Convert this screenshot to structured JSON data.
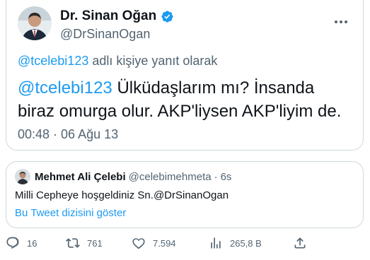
{
  "tweet": {
    "author_name": "Dr. Sinan Oğan",
    "author_handle": "@DrSinanOgan",
    "reply_to_handle": "@tcelebi123",
    "reply_to_suffix": " adlı kişiye yanıt olarak",
    "text_mention": "@tcelebi123",
    "text_body": " Ülküdaşlarım mı? İnsanda biraz omurga olur. AKP'liysen AKP'liyim de.",
    "time": "00:48",
    "separator": " · ",
    "date": "06 Ağu 13"
  },
  "quote": {
    "name": "Mehmet Ali Çelebi",
    "handle": "@celebimehmeta",
    "separator": "·",
    "time": "6s",
    "text": "Milli Cepheye hoşgeldiniz Sn.@DrSinanOgan",
    "link": "Bu Tweet dizisini göster"
  },
  "actions": {
    "replies": "16",
    "retweets": "761",
    "likes": "7.594",
    "views": "265,8 B"
  },
  "colors": {
    "accent": "#1d9bf0",
    "secondary_text": "#536471",
    "border": "#cfd9de"
  },
  "icons": [
    "verified-badge-icon",
    "more-icon",
    "reply-icon",
    "retweet-icon",
    "like-icon",
    "views-icon",
    "share-icon"
  ]
}
